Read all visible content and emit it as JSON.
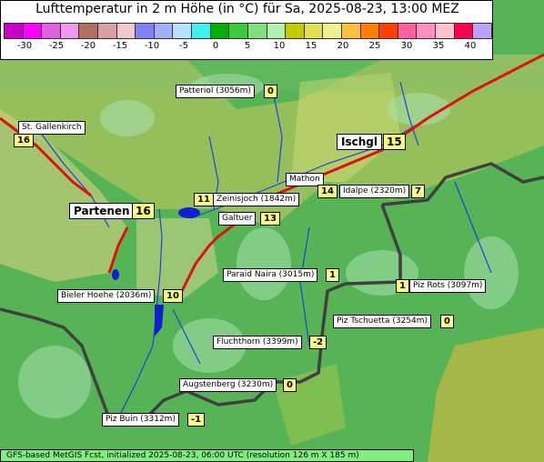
{
  "header": {
    "title": "Lufttemperatur in 2 m Höhe (in °C) für Sa, 2025-08-23, 13:00 MEZ",
    "scale_colors": [
      "#c800c8",
      "#ff00ff",
      "#e060e0",
      "#f098f0",
      "#b07060",
      "#d8a0a0",
      "#f0c8c8",
      "#8080ff",
      "#a0b0ff",
      "#b8e0ff",
      "#40f0f0",
      "#00b000",
      "#40c840",
      "#80e080",
      "#b0f0b0",
      "#c8c800",
      "#e0e050",
      "#f0f090",
      "#ffc040",
      "#ff8000",
      "#ff4000",
      "#ff60a0",
      "#ff90c0",
      "#ffc0d0",
      "#ff0050",
      "#c0a0ff"
    ],
    "scale_ticks": [
      "-30",
      "-25",
      "-20",
      "-15",
      "-10",
      "-5",
      "0",
      "5",
      "10",
      "15",
      "20",
      "25",
      "30",
      "35",
      "40"
    ]
  },
  "places": [
    {
      "name": "Patteriol (3056m)",
      "value": "0"
    },
    {
      "name": "St. Gallenkirch",
      "value": "16"
    },
    {
      "name": "Ischgl",
      "value": "15"
    },
    {
      "name": "Mathon",
      "value": "14"
    },
    {
      "name": "Idalpe (2320m)",
      "value": "7"
    },
    {
      "name": "Zeinisjoch (1842m)",
      "value": "11"
    },
    {
      "name": "Partenen",
      "value": "16"
    },
    {
      "name": "Galtuer",
      "value": "13"
    },
    {
      "name": "Paraid Naira (3015m)",
      "value": "1"
    },
    {
      "name": "Piz Rots (3097m)",
      "value": "1"
    },
    {
      "name": "Bieler Hoehe (2036m)",
      "value": "10"
    },
    {
      "name": "Piz Tschuetta (3254m)",
      "value": "0"
    },
    {
      "name": "Fluchthorn (3399m)",
      "value": "-2"
    },
    {
      "name": "Augstenberg (3230m)",
      "value": "0"
    },
    {
      "name": "Piz Buin (3312m)",
      "value": "-1"
    }
  ],
  "footer": "GFS-based MetGIS Fcst, initialized 2025-08-23, 06:00 UTC  (resolution 126 m X 185 m)"
}
